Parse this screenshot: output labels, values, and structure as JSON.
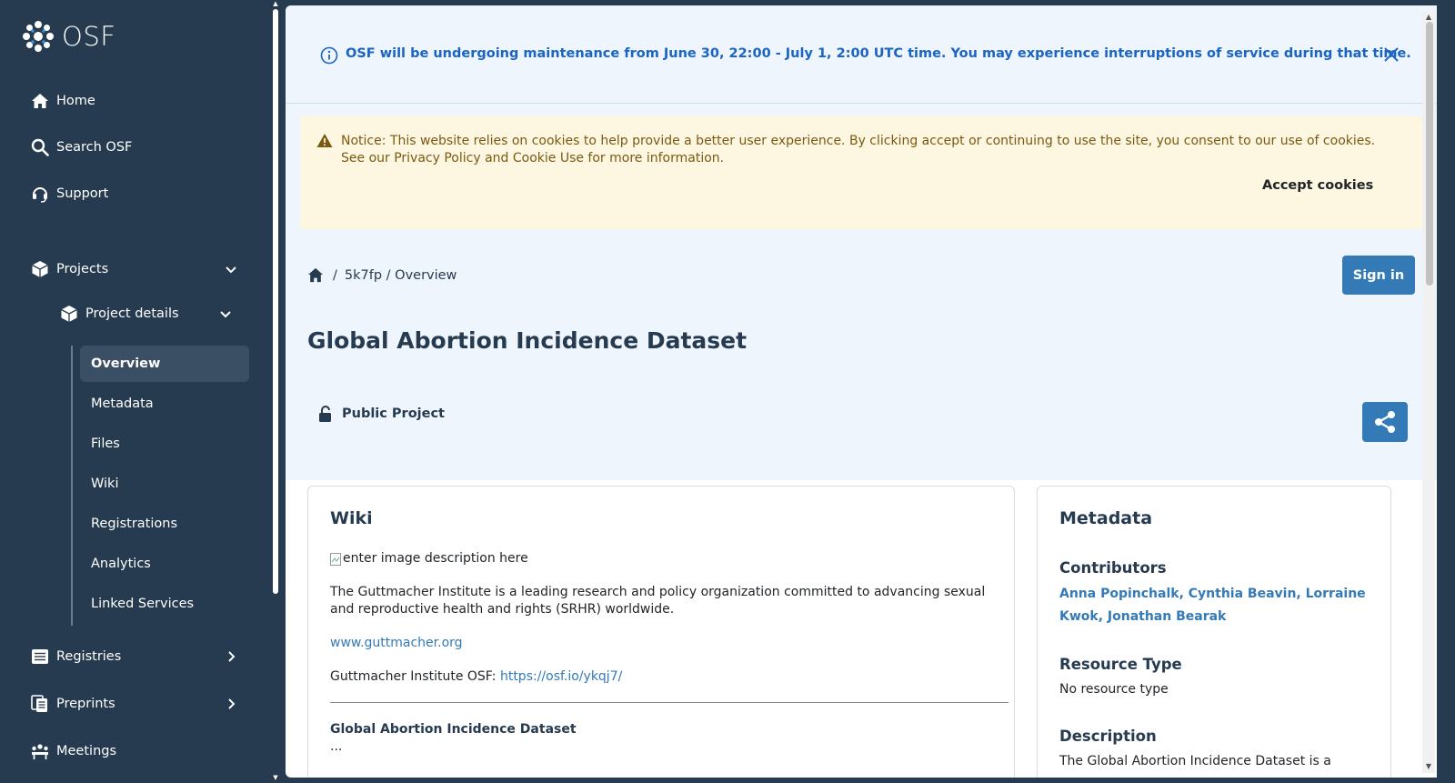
{
  "logo": {
    "text": "OSF"
  },
  "sidebar": {
    "home": "Home",
    "search": "Search OSF",
    "support": "Support",
    "projects": "Projects",
    "project_details": "Project details",
    "sub_items": [
      "Overview",
      "Metadata",
      "Files",
      "Wiki",
      "Registrations",
      "Analytics",
      "Linked Services"
    ],
    "registries": "Registries",
    "preprints": "Preprints",
    "meetings": "Meetings"
  },
  "maintenance": {
    "text": "OSF will be undergoing maintenance from June 30, 22:00 - July 1, 2:00 UTC time. You may experience interruptions of service during that time."
  },
  "cookie": {
    "text": "Notice: This website relies on cookies to help provide a better user experience. By clicking accept or continuing to use the site, you consent to our use of cookies. See our Privacy Policy and Cookie Use for more information.",
    "button": "Accept cookies"
  },
  "breadcrumb": {
    "sep": "/",
    "path": "5k7fp / Overview"
  },
  "sign_in": "Sign in",
  "project": {
    "title": "Global Abortion Incidence Dataset",
    "visibility": "Public Project"
  },
  "wiki": {
    "title": "Wiki",
    "img_alt": "enter image description here",
    "paragraph": "The Guttmacher Institute is a leading research and policy organization committed to advancing sexual and reproductive health and rights (SRHR) worldwide.",
    "link": "www.guttmacher.org",
    "osf_label": "Guttmacher Institute OSF:",
    "osf_link": "https://osf.io/ykqj7/",
    "subtitle": "Global Abortion Incidence Dataset",
    "ellipsis": "..."
  },
  "metadata": {
    "title": "Metadata",
    "contributors_label": "Contributors",
    "contributors": "Anna Popinchalk, Cynthia Beavin, Lorraine Kwok, Jonathan Bearak",
    "resource_type_label": "Resource Type",
    "resource_type": "No resource type",
    "description_label": "Description",
    "description": "The Global Abortion Incidence Dataset is a"
  },
  "colors": {
    "sidebar": "#263b50",
    "primary": "#337ab7",
    "info_bg": "#eef5fd",
    "warning_bg": "#fdf6e0"
  }
}
